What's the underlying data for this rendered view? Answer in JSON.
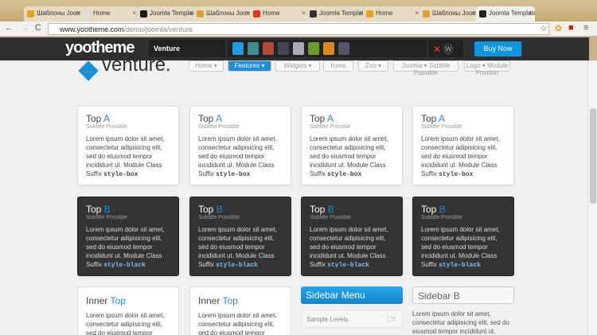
{
  "tabs": [
    {
      "label": "Шаблоны Joomla",
      "color": "#e4a22a"
    },
    {
      "label": "Home",
      "color": "#ddd"
    },
    {
      "label": "Joomla Templates",
      "color": "#1a1a1a"
    },
    {
      "label": "Шаблоны Joomla",
      "color": "#e4a22a"
    },
    {
      "label": "Home",
      "color": "#d32"
    },
    {
      "label": "Joomla Templates",
      "color": "#333"
    },
    {
      "label": "Home",
      "color": "#e4a22a"
    },
    {
      "label": "Шаблоны Joomla",
      "color": "#e4a22a"
    },
    {
      "label": "Joomla Templates",
      "color": "#222",
      "active": true
    }
  ],
  "address": {
    "host": "www.yootheme.com",
    "path": "/demo/joomla/venture"
  },
  "toolbar": {
    "logo": "yootheme",
    "theme_select": "Venture",
    "buy_label": "Buy Now",
    "swatches": [
      "#1e9be0",
      "#3a8f8f",
      "#b24a35",
      "#444650",
      "#a8adb3",
      "#6c9a2c",
      "#d9891e",
      "#555468"
    ]
  },
  "site": {
    "brand": "venture.",
    "menu": [
      {
        "label": "Home ▾"
      },
      {
        "label": "Features ▾",
        "active": true
      },
      {
        "label": "Widgets ▾"
      },
      {
        "label": "Icons"
      },
      {
        "label": "Zoo ▾"
      },
      {
        "label": "Joomla ▾ Subtitle Possible"
      },
      {
        "label": "Logo ▾ Module Position"
      }
    ]
  },
  "cards_white": {
    "title": "Top",
    "accent": "A",
    "subtitle": "Subtitle Possible",
    "body": "Lorem ipsum dolor sit amet, consectetur adipisicing elit, sed do eiusmod tempor incididunt ut. Module Class Suffix",
    "code": "style-box"
  },
  "cards_black": {
    "title": "Top",
    "accent": "B",
    "subtitle": "Subtitle Possible",
    "body": "Lorem ipsum dolor sit amet, consectetur adipisicing elit, sed do eiusmod tempor incididunt ut. Module Class Suffix",
    "code": "style-black"
  },
  "inner": {
    "title": "Inner",
    "accent": "Top",
    "body": "Lorem ipsum dolor sit amet, consectetur adipisicing elit, sed do eiusmod tempor incididunt ut."
  },
  "sidebar_menu": {
    "title": "Sidebar Menu",
    "item": "Sample Levels",
    "toggle": "Off"
  },
  "sidebar_b": {
    "title": "Sidebar B",
    "body": "Lorem ipsum dolor sit amet, consectetur adipisicing elit, sed do eiusmod tempor incididunt ut."
  }
}
